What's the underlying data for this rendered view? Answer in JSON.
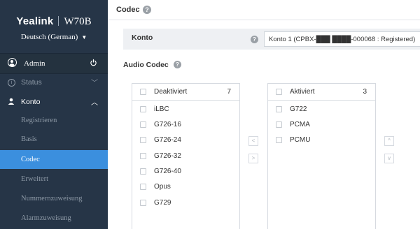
{
  "sidebar": {
    "brand": "Yealink",
    "model": "W70B",
    "language": "Deutsch (German)",
    "user": "Admin",
    "nav": {
      "status": "Status",
      "konto": "Konto"
    },
    "subitems": [
      "Registrieren",
      "Basis",
      "Codec",
      "Erweitert",
      "Nummernzuweisung",
      "Alarmzuweisung"
    ],
    "active_subitem": "Codec"
  },
  "header": {
    "title": "Codec",
    "help_icon": "?"
  },
  "konto": {
    "label": "Konto",
    "help_icon": "?",
    "selected": "Konto 1 (CPBX-███ ████-000068 : Registered)"
  },
  "audio_codec": {
    "title": "Audio Codec",
    "help_icon": "?",
    "disabled": {
      "title": "Deaktiviert",
      "count": "7",
      "items": [
        "iLBC",
        "G726-16",
        "G726-24",
        "G726-32",
        "G726-40",
        "Opus",
        "G729"
      ]
    },
    "enabled": {
      "title": "Aktiviert",
      "count": "3",
      "items": [
        "G722",
        "PCMA",
        "PCMU"
      ]
    },
    "buttons": {
      "move_left": "<",
      "move_right": ">",
      "move_up": "^",
      "move_down": "v"
    }
  },
  "colors": {
    "sidebar_bg": "#263547",
    "active_bg": "#3b8fde"
  }
}
